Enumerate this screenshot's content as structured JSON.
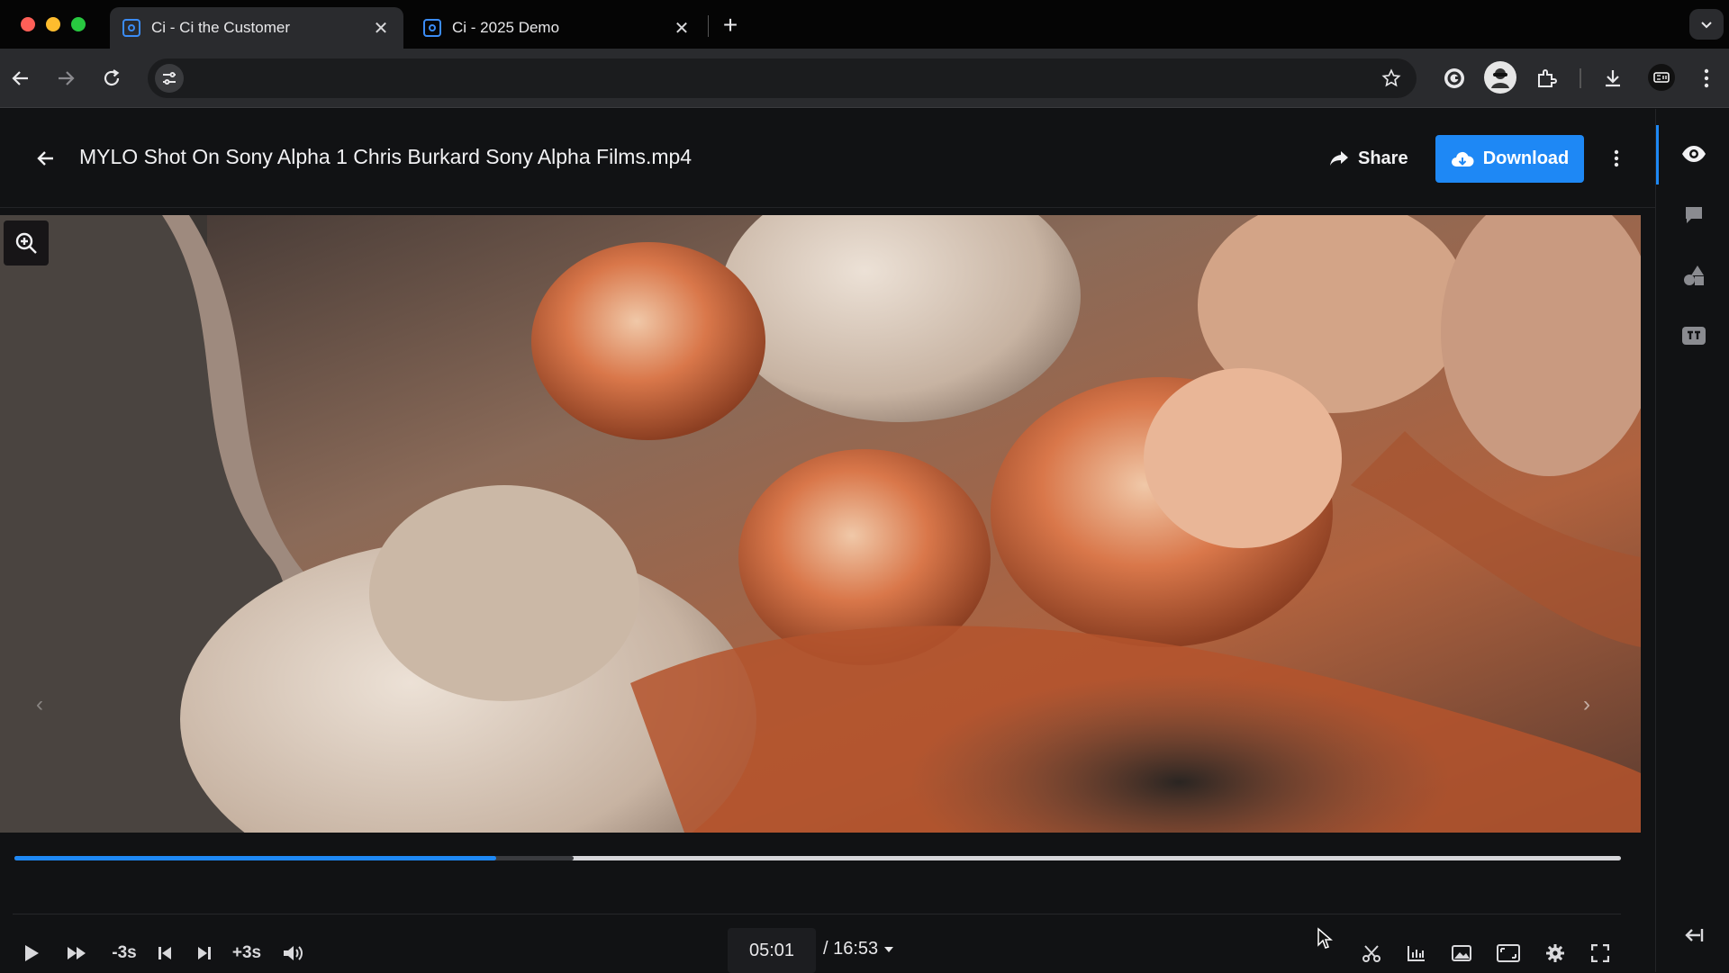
{
  "browser": {
    "tabs": [
      {
        "title": "Ci - Ci the Customer",
        "active": true
      },
      {
        "title": "Ci - 2025 Demo",
        "active": false
      }
    ],
    "new_tab_icon": "plus-icon",
    "address": ""
  },
  "header": {
    "file_title": "MYLO Shot On Sony Alpha 1 Chris Burkard Sony Alpha Films.mp4",
    "share_label": "Share",
    "download_label": "Download"
  },
  "player": {
    "current_time": "05:01",
    "duration": "/ 16:53",
    "skip_back_label": "-3s",
    "skip_forward_label": "+3s",
    "progress_fraction": 0.3,
    "buffered_fraction": 0.348
  },
  "colors": {
    "accent": "#1e88f5",
    "background": "#111214"
  },
  "sidebar": {
    "items": [
      "eye-icon",
      "comment-icon",
      "shapes-icon",
      "captions-icon"
    ],
    "collapse_icon": "collapse-sidebar-icon"
  }
}
